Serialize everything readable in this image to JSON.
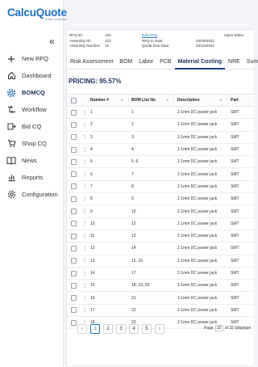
{
  "app": {
    "logo": "CalcuQuote",
    "logo_sub": "aTalk company"
  },
  "sidebar": {
    "items": [
      {
        "label": "New RFQ",
        "icon": "plus-icon"
      },
      {
        "label": "Dashboard",
        "icon": "home-icon"
      },
      {
        "label": "BOMCQ",
        "icon": "gear-icon",
        "active": true
      },
      {
        "label": "Workflow",
        "icon": "workflow-icon"
      },
      {
        "label": "Bid CQ",
        "icon": "bid-icon"
      },
      {
        "label": "Shop CQ",
        "icon": "cart-icon"
      },
      {
        "label": "News",
        "icon": "book-icon"
      },
      {
        "label": "Reports",
        "icon": "reports-icon"
      },
      {
        "label": "Configuration",
        "icon": "settings-icon"
      }
    ]
  },
  "info": {
    "rfq_id_label": "RFQ ID:",
    "rfq_id": "120",
    "assembly_id_label": "Assembly ID:",
    "assembly_id": "122",
    "assembly_number_label": "Assembly Number:",
    "assembly_number": "10",
    "edit_rfq": "Edit RFQ",
    "rfq_in_date_label": "RFQ in Date:",
    "rfq_in_date": "03/08/2022",
    "quote_due_label": "Quote Due Date:",
    "quote_due": "03/15/2022",
    "open_risks_label": "Open Risks:"
  },
  "tabs": [
    "Risk Assessment",
    "BOM",
    "Labor",
    "PCB",
    "Material Costing",
    "NRE",
    "Sum"
  ],
  "active_tab": "Material Costing",
  "pricing": "PRICING: 95.57%",
  "table": {
    "headers": {
      "number": "Number #",
      "bom": "BOM List No",
      "desc": "Description",
      "part": "Part"
    },
    "rows": [
      {
        "num": "1",
        "bom": "1",
        "desc": "2.1mm DC power jack",
        "part": "SMT"
      },
      {
        "num": "2",
        "bom": "2",
        "desc": "2.1mm DC power jack",
        "part": "SMT"
      },
      {
        "num": "3",
        "bom": "3",
        "desc": "2.1mm DC power jack",
        "part": "SMT"
      },
      {
        "num": "4",
        "bom": "4",
        "desc": "2.1mm DC power jack",
        "part": "SMT"
      },
      {
        "num": "5",
        "bom": "5, 6",
        "desc": "2.1mm DC power jack",
        "part": "SMT"
      },
      {
        "num": "6",
        "bom": "7",
        "desc": "2.1mm DC power jack",
        "part": "SMT"
      },
      {
        "num": "7",
        "bom": "8",
        "desc": "2.1mm DC power jack",
        "part": "SMT"
      },
      {
        "num": "8",
        "bom": "9",
        "desc": "2.1mm DC power jack",
        "part": "SMT"
      },
      {
        "num": "9",
        "bom": "10",
        "desc": "2.1mm DC power jack",
        "part": "SMT"
      },
      {
        "num": "10",
        "bom": "12",
        "desc": "2.1mm DC power jack",
        "part": "SMT"
      },
      {
        "num": "11",
        "bom": "13",
        "desc": "2.1mm DC power jack",
        "part": "SMT"
      },
      {
        "num": "12",
        "bom": "14",
        "desc": "2.1mm DC power jack",
        "part": "SMT"
      },
      {
        "num": "13",
        "bom": "15, 16",
        "desc": "2.1mm DC power jack",
        "part": "SMT"
      },
      {
        "num": "14",
        "bom": "17",
        "desc": "2.1mm DC power jack",
        "part": "SMT"
      },
      {
        "num": "15",
        "bom": "18, 19, 20",
        "desc": "2.1mm DC power jack",
        "part": "SMT"
      },
      {
        "num": "16",
        "bom": "21",
        "desc": "2.1mm DC power jack",
        "part": "SMT"
      },
      {
        "num": "17",
        "bom": "22",
        "desc": "2.1mm DC power jack",
        "part": "SMT"
      },
      {
        "num": "18",
        "bom": "23",
        "desc": "2.1mm DC power jack",
        "part": "SMT"
      }
    ]
  },
  "pager": {
    "prev": "‹",
    "next": "›",
    "pages": [
      "1",
      "2",
      "3",
      "4",
      "5"
    ],
    "current": "1",
    "page_label": "Page",
    "page_value": "10",
    "page_suffix": "of 32 (displaye"
  },
  "colors": {
    "brand": "#1f6fbf",
    "navy": "#1a2f5a"
  }
}
